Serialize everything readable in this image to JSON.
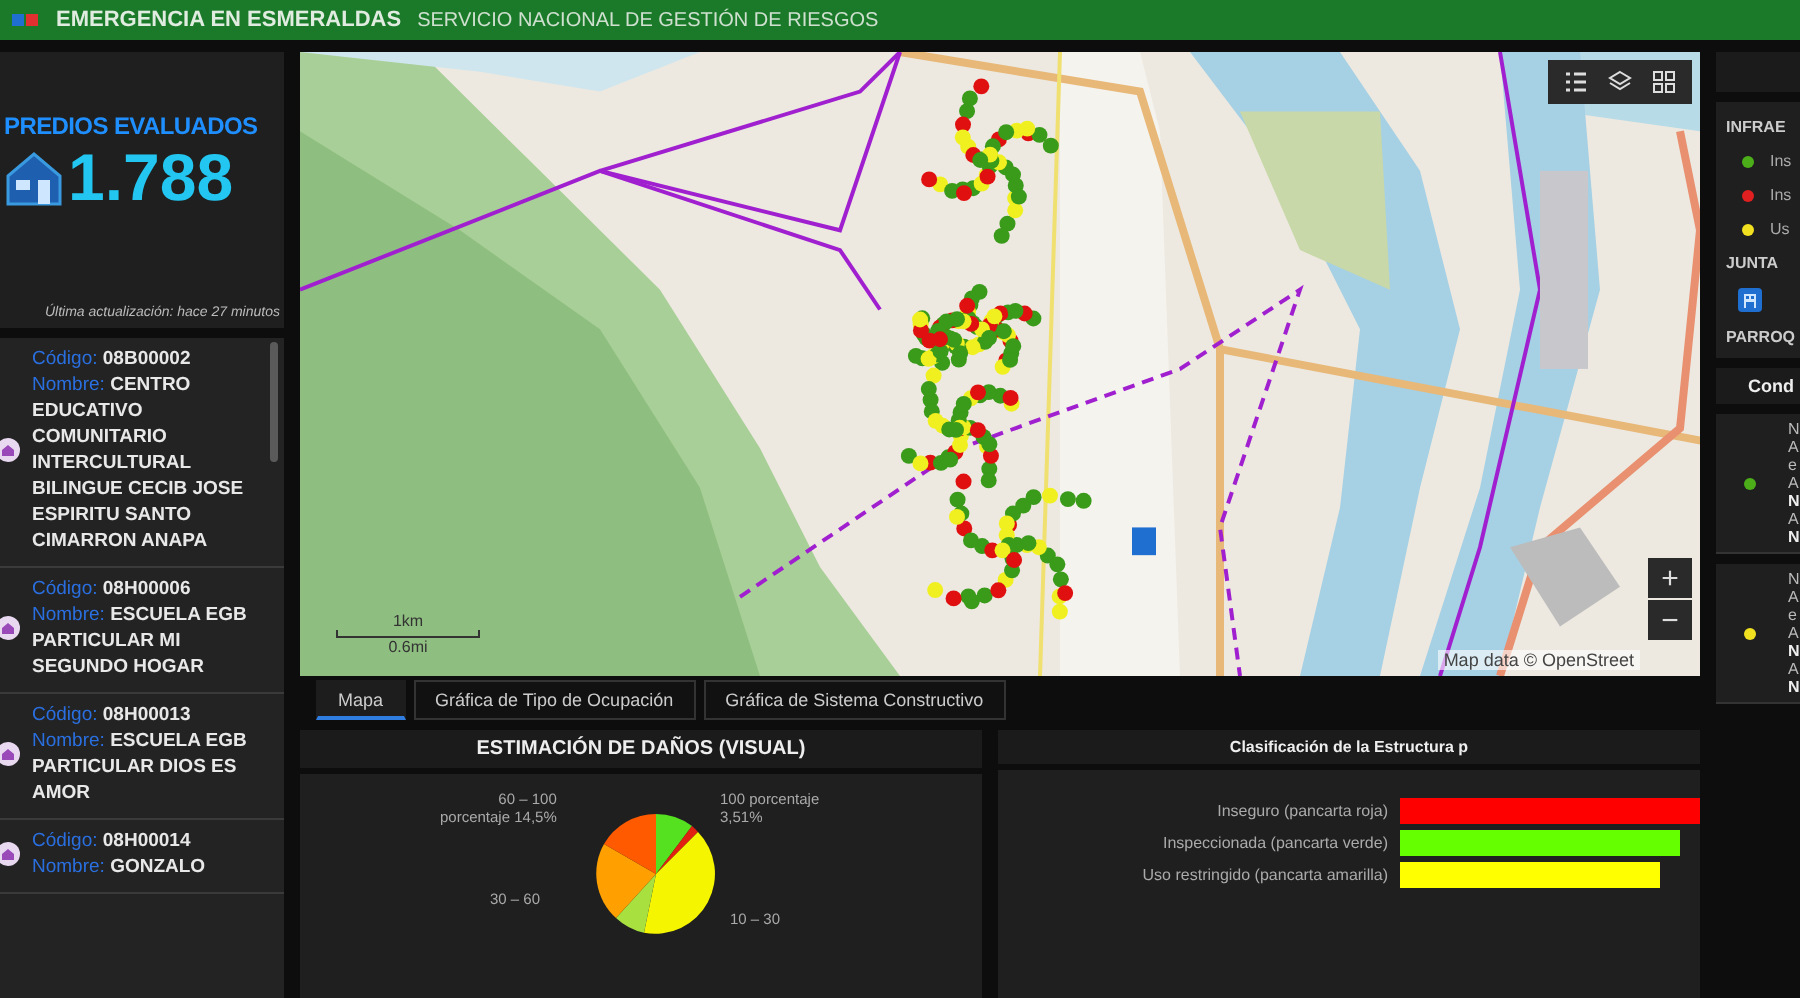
{
  "header": {
    "title": "EMERGENCIA EN ESMERALDAS",
    "subtitle": "SERVICIO NACIONAL DE GESTIÓN DE RIESGOS"
  },
  "kpi": {
    "title": "PREDIOS EVALUADOS",
    "value": "1.788",
    "updated": "Última actualización: hace 27 minutos"
  },
  "schools": [
    {
      "code_label": "Código:",
      "code": "08B00002",
      "name_label": "Nombre:",
      "name": "CENTRO EDUCATIVO COMUNITARIO INTERCULTURAL BILINGUE CECIB JOSE ESPIRITU SANTO CIMARRON ANAPA"
    },
    {
      "code_label": "Código:",
      "code": "08H00006",
      "name_label": "Nombre:",
      "name": "ESCUELA EGB PARTICULAR MI SEGUNDO HOGAR"
    },
    {
      "code_label": "Código:",
      "code": "08H00013",
      "name_label": "Nombre:",
      "name": "ESCUELA EGB PARTICULAR DIOS ES AMOR"
    },
    {
      "code_label": "Código:",
      "code": "08H00014",
      "name_label": "Nombre:",
      "name": "GONZALO"
    }
  ],
  "map": {
    "zoom_in": "+",
    "zoom_out": "−",
    "scale_km": "1km",
    "scale_mi": "0.6mi",
    "attribution": "Map data © OpenStreet"
  },
  "tabs": [
    {
      "label": "Mapa",
      "selected": true
    },
    {
      "label": "Gráfica de Tipo de Ocupación",
      "selected": false
    },
    {
      "label": "Gráfica de Sistema Constructivo",
      "selected": false
    }
  ],
  "damage_panel": {
    "title": "ESTIMACIÓN DE DAÑOS (VISUAL)",
    "labels": [
      {
        "kind": "upper-left",
        "lines": [
          "60 – 100",
          "porcentaje 14,5%"
        ]
      },
      {
        "kind": "upper-right",
        "lines": [
          "100 porcentaje",
          "3,51%"
        ]
      },
      {
        "kind": "lower-left",
        "lines": [
          "30 – 60"
        ]
      },
      {
        "kind": "lower-right",
        "lines": [
          "10 – 30"
        ]
      }
    ]
  },
  "structure_panel": {
    "title": "Clasificación de la Estructura p",
    "bars": [
      {
        "label": "Inseguro (pancarta roja)",
        "color": "#ff0000"
      },
      {
        "label": "Inspeccionada (pancarta verde)",
        "color": "#66ff00"
      },
      {
        "label": "Uso restringido (pancarta amarilla)",
        "color": "#ffff00"
      }
    ]
  },
  "right_panel": {
    "section": "INFRAE",
    "legend": [
      {
        "label": "Ins",
        "color": "#4caf1a"
      },
      {
        "label": "Ins",
        "color": "#e02020"
      },
      {
        "label": "Us",
        "color": "#f0e020"
      }
    ],
    "section_2": "JUNTA",
    "section_3": "PARROQ",
    "list_title": "Cond",
    "items": [
      {
        "color": "#4caf1a",
        "lines": [
          {
            "text": "N",
            "bold": false
          },
          {
            "text": "A",
            "bold": false
          },
          {
            "text": "e",
            "bold": false
          },
          {
            "text": "A",
            "bold": false
          },
          {
            "text": "N",
            "bold": true
          },
          {
            "text": "A",
            "bold": false
          },
          {
            "text": "N",
            "bold": true
          }
        ]
      },
      {
        "color": "#f0e020",
        "lines": [
          {
            "text": "N",
            "bold": false
          },
          {
            "text": "A",
            "bold": false
          },
          {
            "text": "e",
            "bold": false
          },
          {
            "text": "A",
            "bold": false
          },
          {
            "text": "N",
            "bold": true
          },
          {
            "text": "A",
            "bold": false
          },
          {
            "text": "N",
            "bold": true
          }
        ]
      }
    ]
  }
}
